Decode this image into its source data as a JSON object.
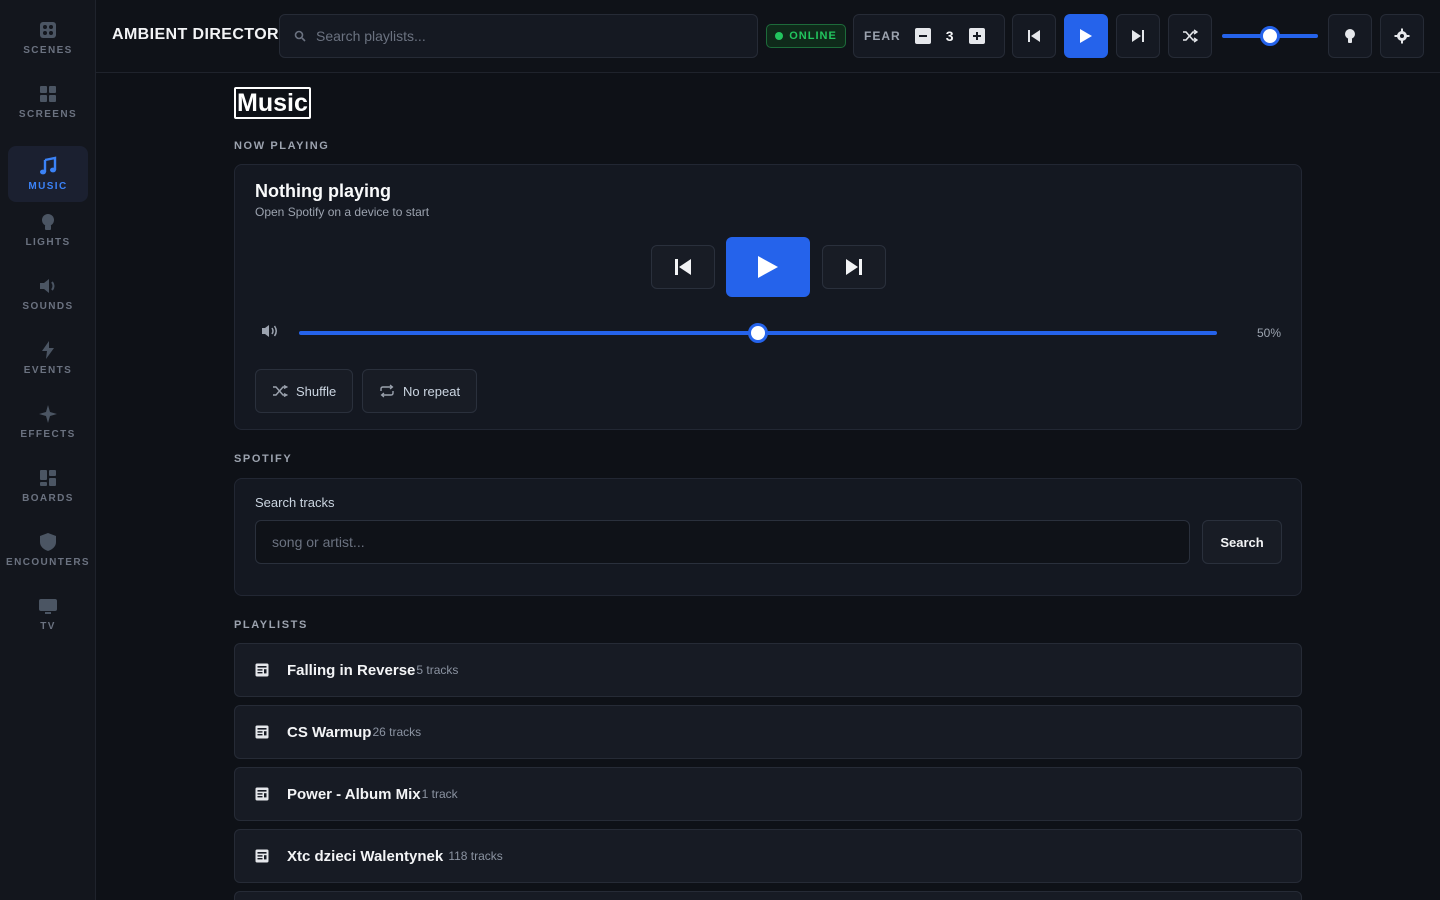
{
  "sidebar": {
    "items": [
      {
        "label": "SCENES",
        "icon": "scenes-icon"
      },
      {
        "label": "SCREENS",
        "icon": "screens-icon"
      },
      {
        "label": "MUSIC",
        "icon": "music-icon",
        "active": true
      },
      {
        "label": "LIGHTS",
        "icon": "bulb-icon"
      },
      {
        "label": "SOUNDS",
        "icon": "speaker-icon"
      },
      {
        "label": "EVENTS",
        "icon": "bolt-icon"
      },
      {
        "label": "EFFECTS",
        "icon": "sparkle-icon"
      },
      {
        "label": "BOARDS",
        "icon": "boards-icon"
      },
      {
        "label": "ENCOUNTERS",
        "icon": "shield-icon"
      },
      {
        "label": "TV",
        "icon": "tv-icon"
      }
    ]
  },
  "header": {
    "brand": "AMBIENT DIRECTOR",
    "search_placeholder": "Search playlists...",
    "status": "ONLINE",
    "fear_label": "FEAR",
    "fear_value": "3",
    "volume_level": 0.5
  },
  "page": {
    "title": "Music"
  },
  "now_playing": {
    "section_label": "NOW PLAYING",
    "title": "Nothing playing",
    "subtitle": "Open Spotify on a device to start",
    "volume_percent": "50%",
    "volume_level": 0.5,
    "shuffle_label": "Shuffle",
    "repeat_label": "No repeat"
  },
  "spotify": {
    "section_label": "SPOTIFY",
    "search_label": "Search tracks",
    "search_placeholder": "song or artist...",
    "search_button": "Search"
  },
  "playlists": {
    "section_label": "PLAYLISTS",
    "items": [
      {
        "name": "Falling in Reverse",
        "count": "5 tracks"
      },
      {
        "name": "CS Warmup",
        "count": "26 tracks"
      },
      {
        "name": "Power - Album Mix",
        "count": "1 track"
      },
      {
        "name": "Xtc dzieci Walentynek ",
        "count": "118 tracks"
      }
    ]
  },
  "colors": {
    "accent": "#2563eb",
    "online": "#22c55e",
    "background": "#0e1117"
  }
}
